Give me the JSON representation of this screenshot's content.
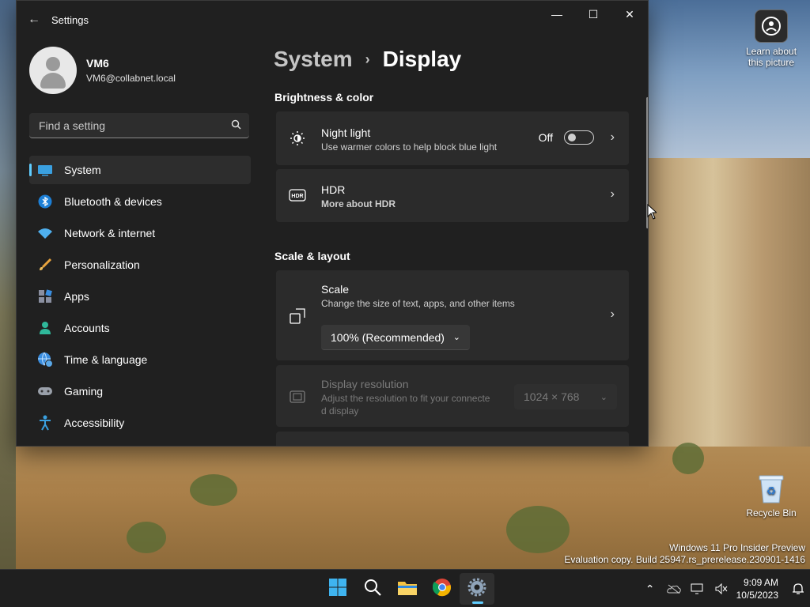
{
  "desktop": {
    "icons": [
      {
        "label": "Learn about this picture"
      },
      {
        "label": "Recycle Bin"
      }
    ],
    "watermark": {
      "line1": "Windows 11 Pro Insider Preview",
      "line2": "Evaluation copy. Build 25947.rs_prerelease.230901-1416"
    }
  },
  "window": {
    "title": "Settings",
    "controls": {
      "minimize": "—",
      "maximize": "☐",
      "close": "✕"
    }
  },
  "profile": {
    "name": "VM6",
    "email": "VM6@collabnet.local"
  },
  "search": {
    "placeholder": "Find a setting"
  },
  "sidebar": {
    "items": [
      {
        "label": "System",
        "icon": "system-icon",
        "active": true
      },
      {
        "label": "Bluetooth & devices",
        "icon": "bluetooth-icon"
      },
      {
        "label": "Network & internet",
        "icon": "wifi-icon"
      },
      {
        "label": "Personalization",
        "icon": "brush-icon"
      },
      {
        "label": "Apps",
        "icon": "apps-icon"
      },
      {
        "label": "Accounts",
        "icon": "person-icon"
      },
      {
        "label": "Time & language",
        "icon": "globe-clock-icon"
      },
      {
        "label": "Gaming",
        "icon": "gamepad-icon"
      },
      {
        "label": "Accessibility",
        "icon": "accessibility-icon"
      }
    ]
  },
  "breadcrumb": {
    "parent": "System",
    "current": "Display"
  },
  "sections": {
    "brightness": {
      "title": "Brightness & color",
      "night_light": {
        "title": "Night light",
        "subtitle": "Use warmer colors to help block blue light",
        "state": "Off"
      },
      "hdr": {
        "title": "HDR",
        "link": "More about HDR"
      }
    },
    "scale_layout": {
      "title": "Scale & layout",
      "scale": {
        "title": "Scale",
        "subtitle": "Change the size of text, apps, and other items",
        "value": "100% (Recommended)"
      },
      "resolution": {
        "title": "Display resolution",
        "subtitle_line1": "Adjust the resolution to fit your connecte",
        "subtitle_line2": "d display",
        "value": "1024 × 768"
      }
    }
  },
  "taskbar": {
    "apps": [
      "start-icon",
      "search-icon",
      "file-explorer-icon",
      "chrome-icon",
      "settings-icon"
    ],
    "time": "9:09 AM",
    "date": "10/5/2023"
  },
  "colors": {
    "accent": "#60cdff",
    "window_bg": "#202020",
    "card_bg": "#2b2b2b",
    "link": "#99ebff"
  }
}
